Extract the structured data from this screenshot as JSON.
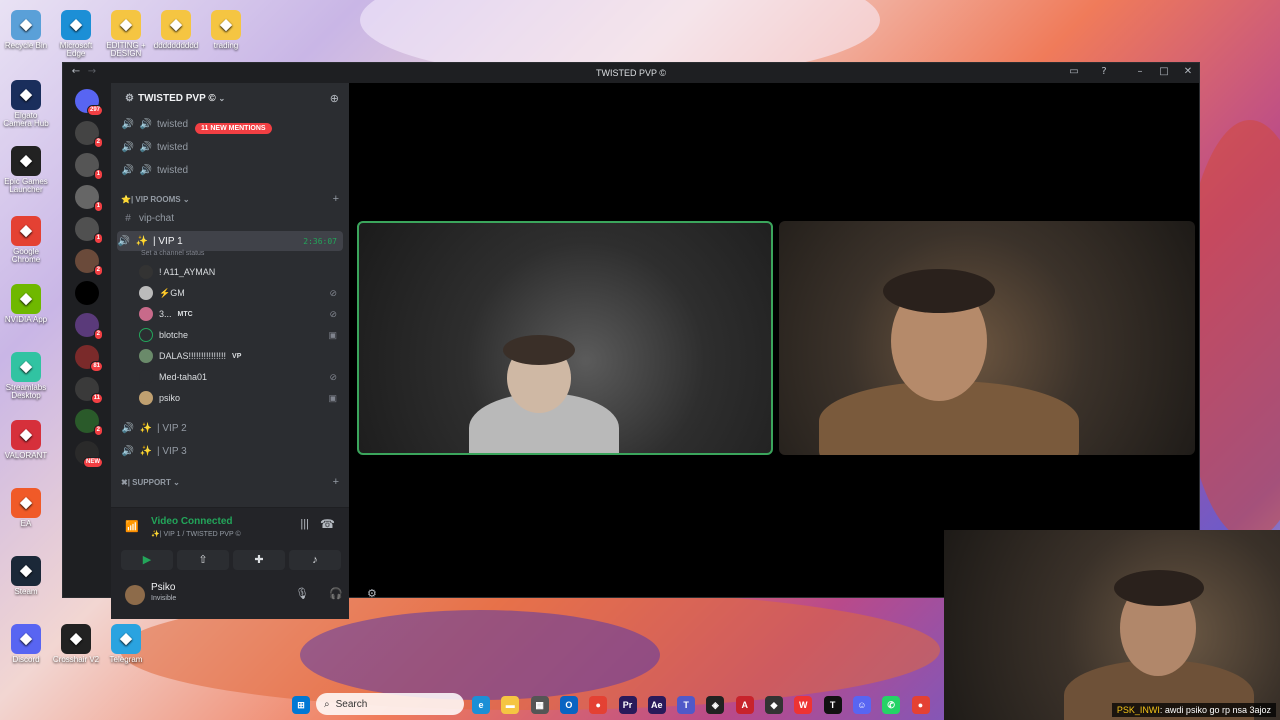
{
  "desktop": {
    "icons": [
      {
        "label": "Recycle Bin",
        "icon": "recycle-bin-icon",
        "color": "#5aa0d8"
      },
      {
        "label": "Microsoft Edge",
        "icon": "edge-icon",
        "color": "#1c8fd6"
      },
      {
        "label": "EDITING + DESIGN",
        "icon": "folder-icon",
        "color": "#f5c542"
      },
      {
        "label": "dddddddddd",
        "icon": "folder-icon",
        "color": "#f5c542"
      },
      {
        "label": "trading",
        "icon": "folder-icon",
        "color": "#f5c542"
      },
      {
        "label": "Elgato Camera Hub",
        "icon": "camera-icon",
        "color": "#1a2e5c"
      },
      {
        "label": "Epic Games Launcher",
        "icon": "epic-icon",
        "color": "#222"
      },
      {
        "label": "Google Chrome",
        "icon": "chrome-icon",
        "color": "#e44133"
      },
      {
        "label": "NVIDIA App",
        "icon": "nvidia-icon",
        "color": "#6fb800"
      },
      {
        "label": "Streamlabs Desktop",
        "icon": "streamlabs-icon",
        "color": "#31c3a2"
      },
      {
        "label": "VALORANT",
        "icon": "valorant-icon",
        "color": "#d6303b"
      },
      {
        "label": "EA",
        "icon": "ea-icon",
        "color": "#f05a28"
      },
      {
        "label": "Steam",
        "icon": "steam-icon",
        "color": "#1b2838"
      },
      {
        "label": "Discord",
        "icon": "discord-icon",
        "color": "#5865f2"
      },
      {
        "label": "Crosshair V2",
        "icon": "crosshair-icon",
        "color": "#222"
      },
      {
        "label": "Telegram",
        "icon": "telegram-icon",
        "color": "#2aa3e0"
      }
    ]
  },
  "window": {
    "title": "TWISTED PVP ©"
  },
  "server_rail": {
    "items": [
      {
        "badge": "297"
      },
      {
        "badge": "2"
      },
      {
        "badge": "1"
      },
      {
        "badge": "1"
      },
      {
        "badge": "1"
      },
      {
        "badge": "2"
      },
      {
        "badge": ""
      },
      {
        "badge": "2"
      },
      {
        "badge": "81"
      },
      {
        "badge": "11"
      },
      {
        "badge": "2"
      },
      {
        "badge": "NEW"
      }
    ]
  },
  "channels": {
    "server_name": "TWISTED PVP ©",
    "mentions": "11 NEW MENTIONS",
    "voice_top": [
      "twisted",
      "twisted",
      "twisted"
    ],
    "vip_category": "VIP ROOMS",
    "vip_chat": "vip-chat",
    "vip1": {
      "name": "| VIP 1",
      "timer": "2:36:07",
      "status": "Set a channel status"
    },
    "members": [
      {
        "name": "! A11_AYMAN",
        "tag": ""
      },
      {
        "name": "⚡GM",
        "tag": ""
      },
      {
        "name": "3...",
        "tag": "MTC"
      },
      {
        "name": "blotche",
        "tag": ""
      },
      {
        "name": "DALAS!!!!!!!!!!!!!!!",
        "tag": "VP"
      },
      {
        "name": "Med-taha01",
        "tag": ""
      },
      {
        "name": "psiko",
        "tag": ""
      }
    ],
    "vip2": "| VIP 2",
    "vip3": "| VIP 3",
    "support_category": "SUPPORT"
  },
  "voice_panel": {
    "status": "Video Connected",
    "location": "| VIP 1 / TWISTED PVP ©"
  },
  "user_panel": {
    "name": "Psiko",
    "status": "Invisible"
  },
  "taskbar": {
    "search": "Search"
  },
  "overlay": {
    "chat_user": "PSK_INWI",
    "chat_text": ": awdi psiko go rp nsa 3ajoz"
  }
}
